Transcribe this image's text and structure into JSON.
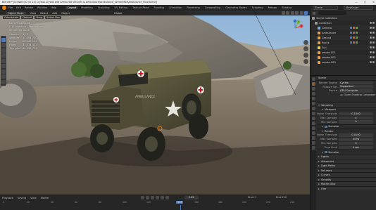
{
  "window": {
    "title": "Blender* [D:\\Work\\02 Jul 23\\ Crystal Crystal and Armoured Vehicles & Ambulance\\Ambulance_Scene\\Mod\\Ambulance_Final.blend]",
    "controls": [
      "—",
      "□",
      "✕"
    ]
  },
  "menubar": {
    "items": [
      "File",
      "Edit",
      "Render",
      "Window",
      "Help"
    ],
    "workspaces": [
      "Layout",
      "Modeling",
      "Sculpting",
      "UV Editing",
      "Texture Paint",
      "Shading",
      "Animation",
      "Rendering",
      "Compositing",
      "Geometry Nodes",
      "Scripting",
      "Retopo",
      "Shadow"
    ],
    "active_workspace": "Layout",
    "scene": "Scene",
    "view_layer": "ViewLayer"
  },
  "viewport": {
    "header": {
      "mode": "Object Mode",
      "items": [
        "View",
        "Select",
        "Add",
        "Object"
      ],
      "transform": "Global"
    },
    "sub_header": [
      "Orientation",
      "Default",
      "Drag",
      "Select Box"
    ],
    "stats": {
      "lines": [
        {
          "k": "User Perspective",
          "v": ""
        },
        {
          "k": "(1) Collection | Ambulance",
          "v": ""
        },
        {
          "k": "Rendering Done",
          "v": ""
        },
        {
          "k": "Objects",
          "v": "1 / 9"
        },
        {
          "k": "Vertices",
          "v": "34,294,730"
        },
        {
          "k": "Edges",
          "v": "66,348,136"
        },
        {
          "k": "Faces",
          "v": "34,034,032"
        },
        {
          "k": "Triangles",
          "v": "68,098,774"
        }
      ]
    },
    "gizmo": {
      "x": "X",
      "y": "Y",
      "z": "Z"
    },
    "vehicle_text": "AMBULANCE"
  },
  "timeline": {
    "items": [
      "Playback",
      "Keying",
      "View",
      "Marker"
    ],
    "current_frame": "133",
    "start_label": "Start",
    "start": "1",
    "end_label": "End",
    "end": "250",
    "ruler": [
      "0",
      "20",
      "40",
      "60",
      "80",
      "100",
      "120",
      "140",
      "160",
      "180",
      "200",
      "220",
      "240"
    ]
  },
  "outliner": {
    "title": "Scene Collection",
    "rows": [
      {
        "label": "Collection",
        "color": "#9a9a9a"
      },
      {
        "label": "Camera",
        "color": "#7ab0e0"
      },
      {
        "label": "Ambulance",
        "color": "#e8a24a"
      },
      {
        "label": "Ground",
        "color": "#e8a24a"
      },
      {
        "label": "Rocks",
        "color": "#e8a24a"
      },
      {
        "label": "Sun",
        "color": "#e0d060"
      },
      {
        "label": "smoke.001",
        "color": "#e8a24a"
      },
      {
        "label": "smoke.002",
        "color": "#e8a24a"
      },
      {
        "label": "smoke.003",
        "color": "#e8a24a"
      }
    ]
  },
  "properties": {
    "title": "Scene",
    "render": [
      {
        "k": "Render Engine",
        "v": "Cycles"
      },
      {
        "k": "Feature Set",
        "v": "Supported"
      },
      {
        "k": "Device",
        "v": "GPU Compute"
      }
    ],
    "open_shading_language": "Open Shading Language",
    "sampling_title": "Sampling",
    "viewport_title": "Viewport",
    "viewport_rows": [
      {
        "k": "Noise Threshold",
        "v": "0.1000"
      },
      {
        "k": "Max Samples",
        "v": "4"
      },
      {
        "k": "Min Samples",
        "v": "0"
      }
    ],
    "denoise_label": "Denoise",
    "render_title": "Render",
    "render_rows": [
      {
        "k": "Noise Threshold",
        "v": "0.0100"
      },
      {
        "k": "Max Samples",
        "v": "4096"
      },
      {
        "k": "Min Samples",
        "v": "0"
      },
      {
        "k": "Time Limit",
        "v": "0 sec"
      }
    ],
    "sections": [
      "Lights",
      "Advanced",
      "Light Paths",
      "Volumes",
      "Curves",
      "Simplify",
      "Motion Blur",
      "Film"
    ]
  }
}
